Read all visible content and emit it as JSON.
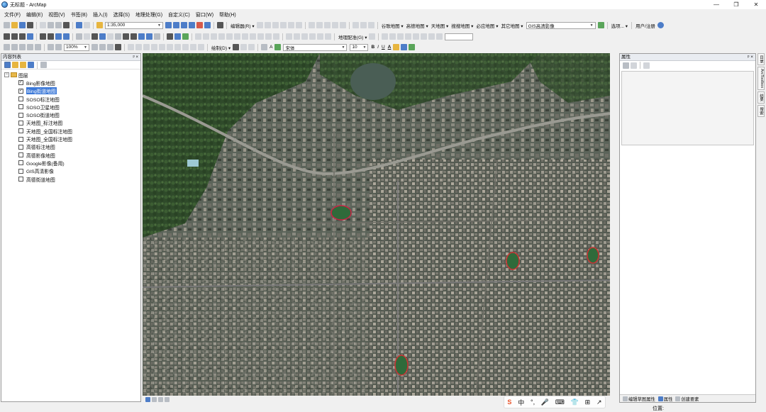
{
  "window": {
    "title": "无标题 - ArcMap",
    "controls": [
      "—",
      "❐",
      "✕"
    ]
  },
  "menu": [
    "文件(F)",
    "编辑(E)",
    "视图(V)",
    "书签(B)",
    "插入(I)",
    "选择(S)",
    "地理处理(G)",
    "自定义(C)",
    "窗口(W)",
    "帮助(H)"
  ],
  "toolbar1": {
    "scale_value": "1:35,000",
    "editor_label": "编辑器(R) ▾",
    "basemap_menus": [
      "谷歌地图 ▾",
      "高德地图 ▾",
      "天地图 ▾",
      "搜搜地图 ▾",
      "必应地图 ▾",
      "其它地图 ▾"
    ],
    "gis_combo": "GIS高清影像",
    "options_label": "选项... ▾",
    "user_label": "用户/注册"
  },
  "toolbar2": {
    "zoom_value": "100%",
    "georef_label": "地理配准(G) ▾"
  },
  "toolbar3": {
    "draw_label": "绘制(D) ▾",
    "font_name": "宋体",
    "font_size": "10",
    "bold": "B",
    "italic": "I",
    "underline": "U",
    "font_color": "A"
  },
  "toc": {
    "title": "内容列表",
    "header_controls": "ᵖ ×",
    "group_label": "图层",
    "layers": [
      {
        "label": "Bing影像地图",
        "checked": true,
        "selected": false
      },
      {
        "label": "Bing街道地图",
        "checked": true,
        "selected": true
      },
      {
        "label": "SOSO标注地图",
        "checked": false,
        "selected": false
      },
      {
        "label": "SOSO卫星地图",
        "checked": false,
        "selected": false
      },
      {
        "label": "SOSO街道地图",
        "checked": false,
        "selected": false
      },
      {
        "label": "天地图_标注地图",
        "checked": false,
        "selected": false
      },
      {
        "label": "天地图_全国标注地图",
        "checked": false,
        "selected": false
      },
      {
        "label": "天地图_全国标注地图",
        "checked": false,
        "selected": false
      },
      {
        "label": "高德标注地图",
        "checked": false,
        "selected": false
      },
      {
        "label": "高德影像地图",
        "checked": false,
        "selected": false
      },
      {
        "label": "Google影像(备用)",
        "checked": false,
        "selected": false
      },
      {
        "label": "GIS高清影像",
        "checked": false,
        "selected": false
      },
      {
        "label": "高德街道地图",
        "checked": false,
        "selected": false
      }
    ]
  },
  "properties": {
    "title": "属性",
    "header_controls": "ᵖ ×",
    "bottom_tabs": [
      "编辑草图属性",
      "属性",
      "创建要素"
    ]
  },
  "side_tabs": [
    "目录",
    "ArcToolbox",
    "结果",
    "搜索"
  ],
  "ime": {
    "items": [
      "S",
      "中",
      "°,",
      "🎤",
      "⌨",
      "👕",
      "⊞",
      "↗"
    ]
  },
  "status": {
    "position_label": "位置:"
  },
  "colors": {
    "accent": "#3b78d8",
    "map_base": "#4a5a45",
    "panel_header": "#e9ecf1"
  }
}
